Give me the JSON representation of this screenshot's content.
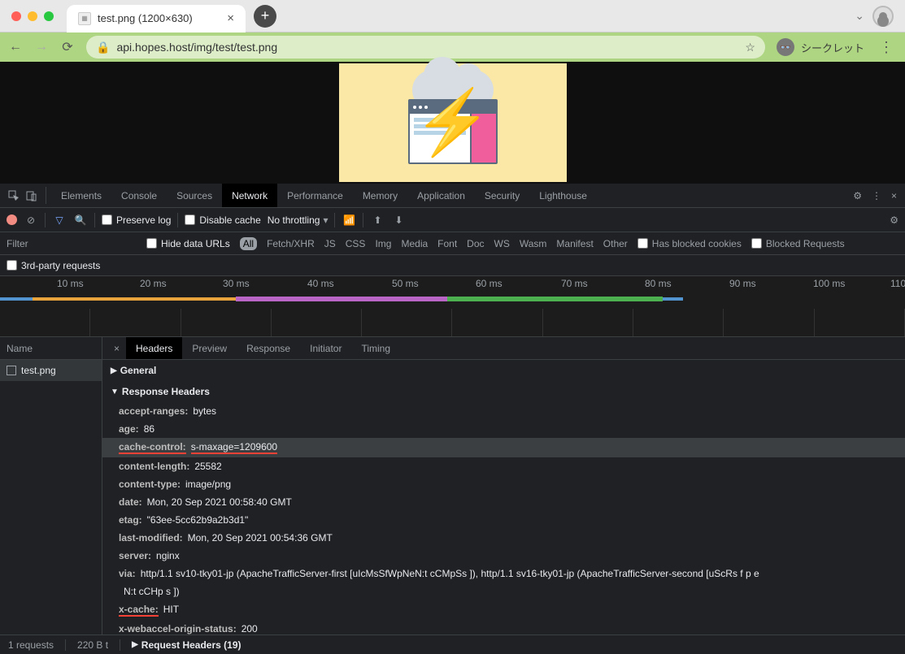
{
  "browser": {
    "tab_title": "test.png (1200×630)",
    "url": "api.hopes.host/img/test/test.png",
    "incognito_label": "シークレット"
  },
  "devtools": {
    "tabs": [
      "Elements",
      "Console",
      "Sources",
      "Network",
      "Performance",
      "Memory",
      "Application",
      "Security",
      "Lighthouse"
    ],
    "active_tab": "Network",
    "filterbar": {
      "preserve_log": "Preserve log",
      "disable_cache": "Disable cache",
      "throttling": "No throttling"
    },
    "typefilter": {
      "placeholder": "Filter",
      "hide_data_urls": "Hide data URLs",
      "chips": [
        "All",
        "Fetch/XHR",
        "JS",
        "CSS",
        "Img",
        "Media",
        "Font",
        "Doc",
        "WS",
        "Wasm",
        "Manifest",
        "Other"
      ],
      "blocked_cookies": "Has blocked cookies",
      "blocked_requests": "Blocked Requests",
      "third_party": "3rd-party requests"
    },
    "timeline_ticks": [
      "10 ms",
      "20 ms",
      "30 ms",
      "40 ms",
      "50 ms",
      "60 ms",
      "70 ms",
      "80 ms",
      "90 ms",
      "100 ms",
      "110"
    ],
    "reqlist": {
      "header": "Name",
      "rows": [
        "test.png"
      ]
    },
    "detail_tabs": [
      "Headers",
      "Preview",
      "Response",
      "Initiator",
      "Timing"
    ],
    "active_detail_tab": "Headers",
    "sections": {
      "general": "General",
      "response_headers": "Response Headers",
      "request_headers": "Request Headers (19)"
    },
    "headers": [
      {
        "k": "accept-ranges:",
        "v": "bytes"
      },
      {
        "k": "age:",
        "v": "86"
      },
      {
        "k": "cache-control:",
        "v": "s-maxage=1209600",
        "hl": true
      },
      {
        "k": "content-length:",
        "v": "25582"
      },
      {
        "k": "content-type:",
        "v": "image/png"
      },
      {
        "k": "date:",
        "v": "Mon, 20 Sep 2021 00:58:40 GMT"
      },
      {
        "k": "etag:",
        "v": "\"63ee-5cc62b9a2b3d1\""
      },
      {
        "k": "last-modified:",
        "v": "Mon, 20 Sep 2021 00:54:36 GMT"
      },
      {
        "k": "server:",
        "v": "nginx"
      },
      {
        "k": "via:",
        "v": "http/1.1 sv10-tky01-jp (ApacheTrafficServer-first [uIcMsSfWpNeN:t cCMpSs ]), http/1.1 sv16-tky01-jp (ApacheTrafficServer-second [uScRs f p e"
      },
      {
        "k": "",
        "v": "N:t cCHp s ])",
        "cont": true
      },
      {
        "k": "x-cache:",
        "v": "HIT",
        "hl2": true
      },
      {
        "k": "x-webaccel-origin-status:",
        "v": "200"
      }
    ],
    "statusbar": {
      "requests": "1 requests",
      "transferred": "220 B t"
    }
  }
}
